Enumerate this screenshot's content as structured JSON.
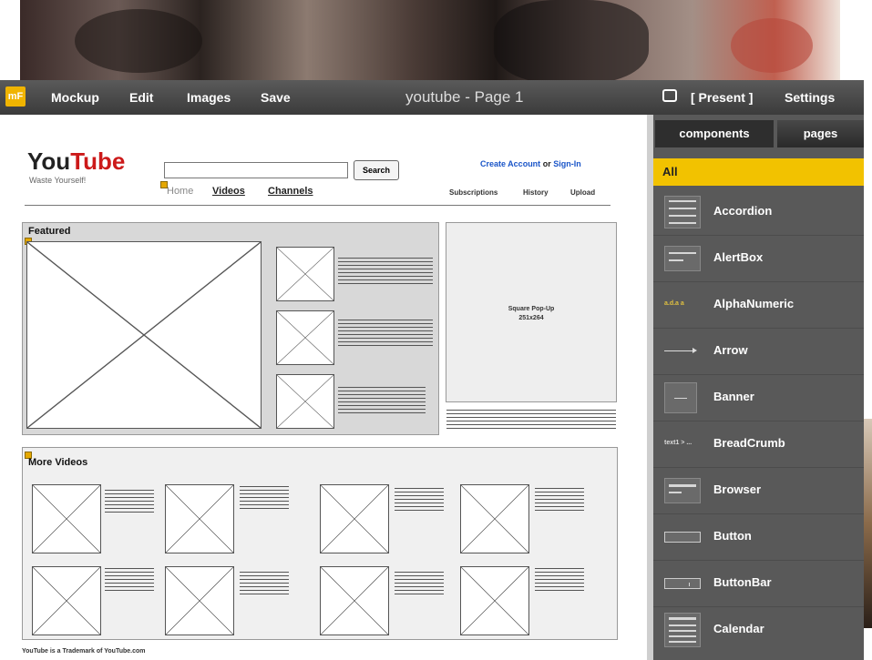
{
  "app": {
    "logo": "mF",
    "menu": [
      "Mockup",
      "Edit",
      "Images",
      "Save"
    ],
    "title": "youtube - Page 1",
    "present": "[ Present ]",
    "settings": "Settings"
  },
  "canvas": {
    "logo_you": "You",
    "logo_tube": "Tube",
    "tagline": "Waste Yourself!",
    "search_button": "Search",
    "nav": [
      "Home",
      "Videos",
      "Channels"
    ],
    "create_account": "Create Account",
    "or": "or",
    "sign_in": "Sign-In",
    "top_links": [
      "Subscriptions",
      "History",
      "Upload"
    ],
    "featured_title": "Featured",
    "popup_line1": "Square Pop-Up",
    "popup_line2": "251x264",
    "more_videos_title": "More Videos",
    "footer": "YouTube is a Trademark of YouTube.com"
  },
  "sidebar": {
    "tabs": [
      "components",
      "pages"
    ],
    "filter": "All",
    "components": [
      {
        "label": "Accordion",
        "icon": "accordion-icon"
      },
      {
        "label": "AlertBox",
        "icon": "alertbox-icon"
      },
      {
        "label": "AlphaNumeric",
        "icon": "alphanumeric-icon",
        "thumb_text": "a.d.a a"
      },
      {
        "label": "Arrow",
        "icon": "arrow-icon"
      },
      {
        "label": "Banner",
        "icon": "banner-icon"
      },
      {
        "label": "BreadCrumb",
        "icon": "breadcrumb-icon",
        "thumb_text": "text1 > ..."
      },
      {
        "label": "Browser",
        "icon": "browser-icon"
      },
      {
        "label": "Button",
        "icon": "button-icon"
      },
      {
        "label": "ButtonBar",
        "icon": "buttonbar-icon"
      },
      {
        "label": "Calendar",
        "icon": "calendar-icon"
      }
    ]
  },
  "colors": {
    "accent": "#f2c200",
    "youtube_red": "#cc1a1a",
    "link_blue": "#1a55c8"
  }
}
